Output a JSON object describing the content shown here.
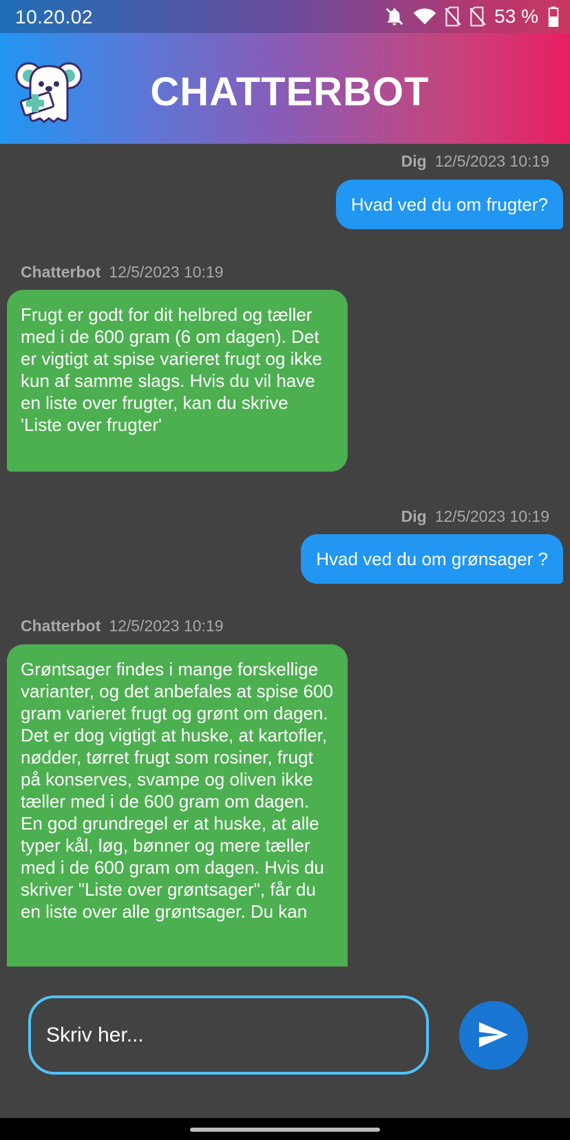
{
  "status_bar": {
    "time": "10.20.02",
    "battery": "53 %",
    "icons": [
      "bell-off-icon",
      "wifi-icon",
      "no-sim-icon",
      "no-sim-icon",
      "battery-icon"
    ]
  },
  "header": {
    "title": "CHATTERBOT",
    "logo": "koala-mascot-icon"
  },
  "messages": [
    {
      "role": "user",
      "sender": "Dig",
      "time": "12/5/2023 10:19",
      "text": "Hvad ved du om frugter?"
    },
    {
      "role": "bot",
      "sender": "Chatterbot",
      "time": "12/5/2023 10:19",
      "text": "Frugt er godt for dit helbred og tæller med i de 600 gram (6 om dagen). Det er vigtigt at spise varieret frugt og ikke kun af samme slags. Hvis du vil have en liste over frugter, kan du skrive 'Liste over frugter'"
    },
    {
      "role": "user",
      "sender": "Dig",
      "time": "12/5/2023 10:19",
      "text": "Hvad ved du om grønsager ?"
    },
    {
      "role": "bot",
      "sender": "Chatterbot",
      "time": "12/5/2023 10:19",
      "text": "Grøntsager findes i mange forskellige varianter, og det anbefales at spise 600 gram varieret frugt og grønt om dagen. Det er dog vigtigt at huske, at kartofler, nødder, tørret frugt som rosiner, frugt på konserves, svampe og oliven ikke tæller med i de 600 gram om dagen. En god grundregel er at huske, at alle typer kål, løg, bønner og mere tæller med i de 600 gram om dagen. Hvis du skriver \"Liste over grøntsager\", får du en liste over alle grøntsager. Du kan"
    }
  ],
  "composer": {
    "placeholder": "Skriv her...",
    "send_icon": "send-icon"
  },
  "colors": {
    "user_bubble": "#2196f3",
    "bot_bubble": "#4caf50",
    "background": "#424242",
    "input_border": "#4fc3f7",
    "send_button": "#1976d2"
  }
}
